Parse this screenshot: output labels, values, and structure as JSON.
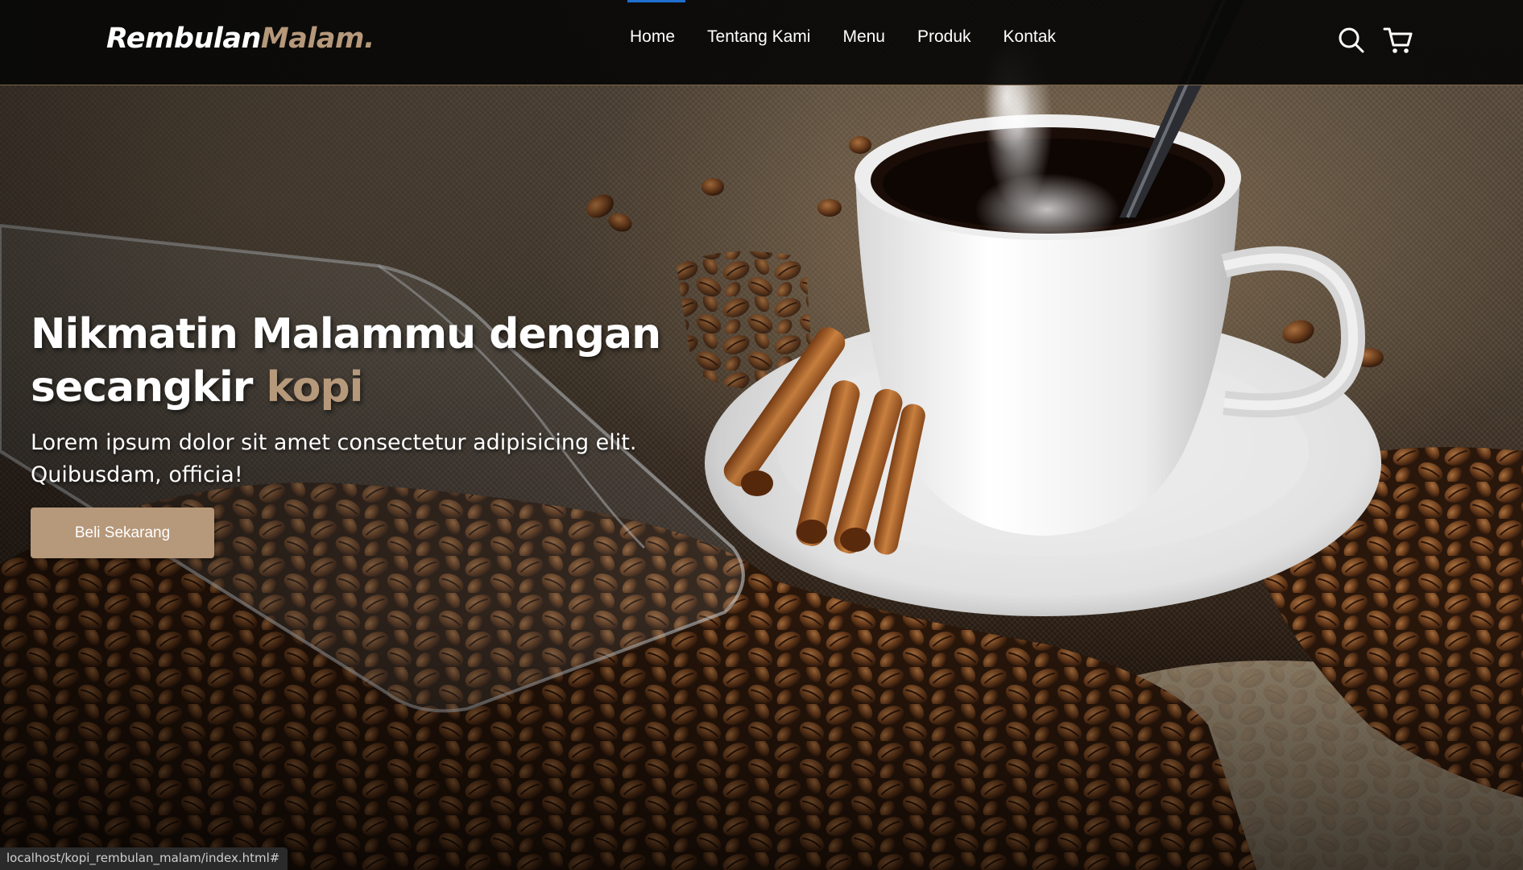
{
  "brand": {
    "name_part1": "Rembulan",
    "name_part2": "Malam."
  },
  "nav": {
    "items": [
      {
        "label": "Home",
        "active": true
      },
      {
        "label": "Tentang Kami"
      },
      {
        "label": "Menu"
      },
      {
        "label": "Produk"
      },
      {
        "label": "Kontak"
      }
    ],
    "icons": [
      "search-icon",
      "cart-icon"
    ]
  },
  "hero": {
    "headline_main": "Nikmatin Malammu dengan secangkir ",
    "headline_accent": "kopi",
    "subtext": "Lorem ipsum dolor sit amet consectetur adipisicing elit. Quibusdam, officia!",
    "cta_label": "Beli Sekarang"
  },
  "status_bar": {
    "url": "localhost/kopi_rembulan_malam/index.html#"
  },
  "colors": {
    "accent": "#b6987a",
    "navbar_bg": "#080706",
    "active_indicator": "#1f6fd1",
    "text": "#ffffff"
  }
}
